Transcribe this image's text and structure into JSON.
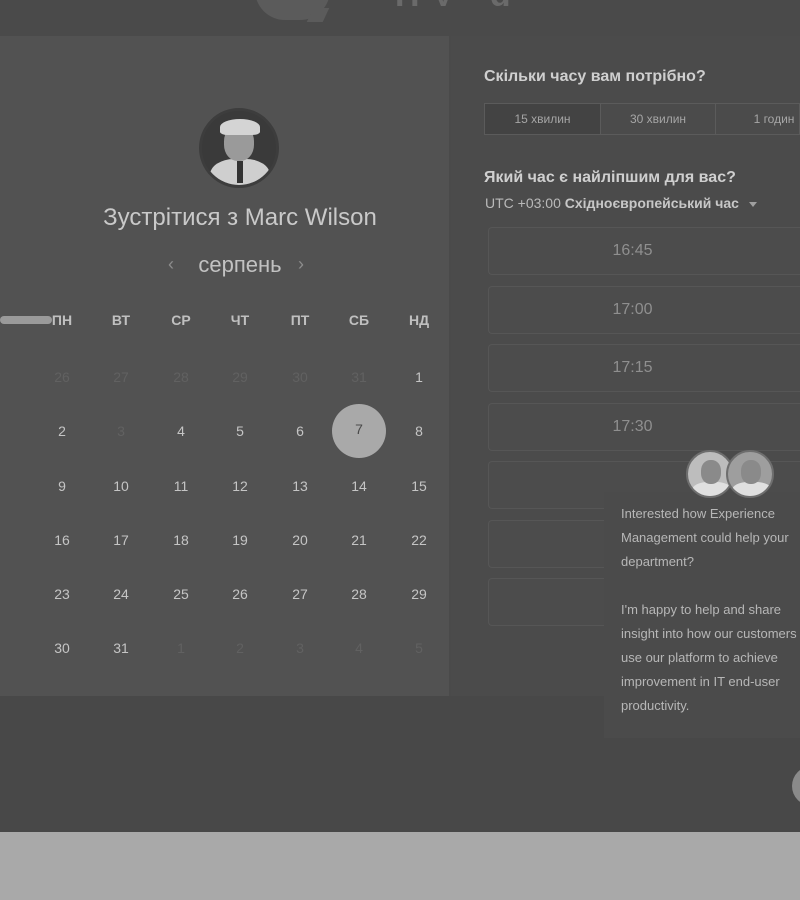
{
  "header": {
    "logo_icon": "chat-bubble-logo-icon"
  },
  "meeting": {
    "title": "Зустрітися з Marc Wilson",
    "month": "серпень",
    "prev_icon": "‹",
    "next_icon": "›"
  },
  "calendar": {
    "weekdays": [
      "ПН",
      "ВТ",
      "СР",
      "ЧТ",
      "ПТ",
      "СБ",
      "НД"
    ],
    "weeks": [
      [
        "26",
        "27",
        "28",
        "29",
        "30",
        "31",
        "1"
      ],
      [
        "2",
        "3",
        "4",
        "5",
        "6",
        "7",
        "8"
      ],
      [
        "9",
        "10",
        "11",
        "12",
        "13",
        "14",
        "15"
      ],
      [
        "16",
        "17",
        "18",
        "19",
        "20",
        "21",
        "22"
      ],
      [
        "23",
        "24",
        "25",
        "26",
        "27",
        "28",
        "29"
      ],
      [
        "30",
        "31",
        "1",
        "2",
        "3",
        "4",
        "5"
      ]
    ],
    "selected": "7"
  },
  "duration": {
    "question": "Скільки часу вам потрібно?",
    "options": [
      "15 хвилин",
      "30 хвилин",
      "1 годин"
    ],
    "selected": "15 хвилин"
  },
  "time": {
    "question": "Який час є найліпшим для вас?",
    "tz_offset": "UTC +03:00",
    "tz_name": "Східноєвропейський час",
    "slots": [
      "16:45",
      "17:00",
      "17:15",
      "17:30",
      "",
      "",
      ""
    ]
  },
  "chat": {
    "paragraph1": "Interested how Experience Management could help your department?",
    "paragraph2": "I'm happy to help and share insight into how our customers use our platform to achieve improvement in IT end-user productivity."
  },
  "colors": {
    "selected_day": "#a9a9a9",
    "overlay": "#4a4a4a"
  }
}
